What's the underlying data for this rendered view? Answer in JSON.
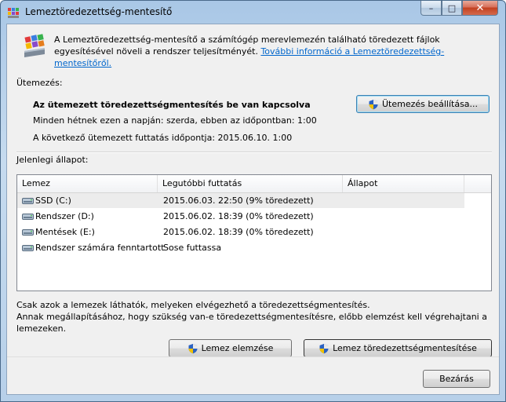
{
  "window": {
    "title": "Lemeztöredezettség-mentesítő",
    "controls": {
      "minimize": "–",
      "maximize": "□",
      "close": "✕"
    }
  },
  "intro": {
    "text": "A Lemeztöredezettség-mentesítő a számítógép merevlemezén található töredezett fájlok egyesítésével növeli a rendszer teljesítményét. ",
    "link": "További információ a Lemeztöredezettség-mentesítőről."
  },
  "schedule": {
    "section_label": "Ütemezés:",
    "status": "Az ütemezett töredezettségmentesítés be van kapcsolva",
    "frequency": "Minden hétnek ezen a napján: szerda, ebben az időpontban: 1:00",
    "next_run": "A következő ütemezett futtatás időpontja: 2015.06.10. 1:00",
    "button": "Ütemezés beállítása..."
  },
  "current_status": {
    "section_label": "Jelenlegi állapot:",
    "columns": [
      "Lemez",
      "Legutóbbi futtatás",
      "Állapot"
    ],
    "rows": [
      {
        "disk": "SSD (C:)",
        "last_run": "2015.06.03. 22:50 (9% töredezett)",
        "status": "",
        "icon": "ssd-drive-icon",
        "selected": true
      },
      {
        "disk": "Rendszer (D:)",
        "last_run": "2015.06.02. 18:39 (0% töredezett)",
        "status": "",
        "icon": "hard-drive-icon",
        "selected": false
      },
      {
        "disk": "Mentések (E:)",
        "last_run": "2015.06.02. 18:39 (0% töredezett)",
        "status": "",
        "icon": "hard-drive-icon",
        "selected": false
      },
      {
        "disk": "Rendszer számára fenntartott",
        "last_run": "Sose futtassa",
        "status": "",
        "icon": "hard-drive-icon",
        "selected": false
      }
    ]
  },
  "footer": {
    "note": "Csak azok a lemezek láthatók, melyeken elvégezhető a töredezettségmentesítés.",
    "note2": "Annak megállapításához, hogy szükség van-e töredezettségmentesítésre, előbb elemzést kell végrehajtani a lemezeken.",
    "analyze_button": "Lemez elemzése",
    "defrag_button": "Lemez töredezettségmentesítése",
    "close_button": "Bezárás"
  },
  "colors": {
    "link": "#0066cc",
    "titlebar": "#b7d0e9",
    "close": "#c2401f"
  }
}
